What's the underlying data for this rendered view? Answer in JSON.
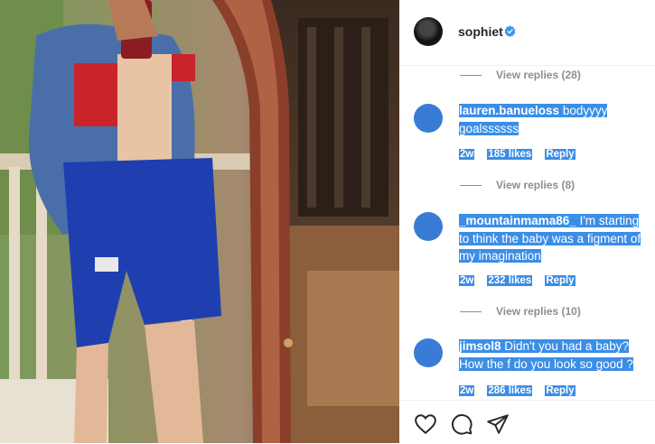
{
  "post": {
    "username": "sophiet"
  },
  "icons": {
    "verified": "verified-badge-icon",
    "like": "heart-icon",
    "comment": "comment-bubble-icon",
    "share": "paper-plane-icon"
  },
  "colors": {
    "selection": "#3a8ee6",
    "verified": "#3897f0"
  },
  "comments": [
    {
      "view_replies": "View replies (28)"
    },
    {
      "user": "lauren.banueloss",
      "text": "bodyyyy goalssssss",
      "age": "2w",
      "likes": "185 likes",
      "reply": "Reply",
      "view_replies": "View replies (8)"
    },
    {
      "user": "_mountainmama86_",
      "text": "I'm starting to think the baby was a figment of my imagination",
      "age": "2w",
      "likes": "232 likes",
      "reply": "Reply",
      "view_replies": "View replies (10)"
    },
    {
      "user": "jimsol8",
      "text": "Didn't you had a baby? How the f do you look so good ?",
      "age": "2w",
      "likes": "286 likes",
      "reply": "Reply"
    }
  ]
}
